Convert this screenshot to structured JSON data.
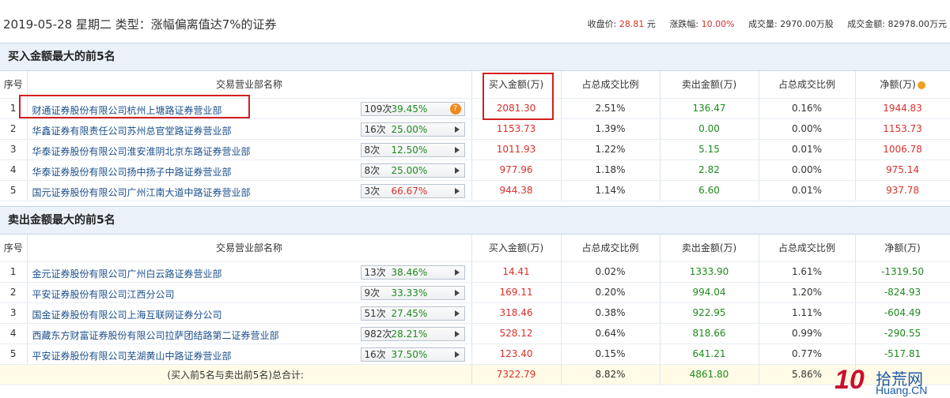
{
  "header": {
    "title": "2019-05-28 星期二  类型：涨幅偏离值达7%的证券",
    "stats": [
      {
        "label": "收盘价:",
        "value": "28.81",
        "unit": "元"
      },
      {
        "label": "涨跌幅:",
        "value": "10.00%",
        "unit": ""
      },
      {
        "label": "成交量:",
        "value": "2970.00万股",
        "unit": ""
      },
      {
        "label": "成交金额:",
        "value": "82978.00万元",
        "unit": ""
      }
    ]
  },
  "buy_section": {
    "title": "买入金额最大的前5名",
    "columns": [
      "序号",
      "交易营业部名称",
      "买入金额(万)",
      "占总成交比例",
      "卖出金额(万)",
      "占总成交比例",
      "净额(万)"
    ],
    "rows": [
      {
        "idx": "1",
        "name": "财通证券股份有限公司杭州上塘路证券营业部",
        "count": "109次",
        "pct": "39.45%",
        "buy": "2081.30",
        "buy_ratio": "2.51%",
        "sell": "136.47",
        "sell_ratio": "0.16%",
        "net": "1944.83"
      },
      {
        "idx": "2",
        "name": "华鑫证券有限责任公司苏州总官堂路证券营业部",
        "count": "16次",
        "pct": "25.00%",
        "buy": "1153.73",
        "buy_ratio": "1.39%",
        "sell": "0.00",
        "sell_ratio": "0.00%",
        "net": "1153.73"
      },
      {
        "idx": "3",
        "name": "华泰证券股份有限公司淮安淮阴北京东路证券营业部",
        "count": "8次",
        "pct": "12.50%",
        "buy": "1011.93",
        "buy_ratio": "1.22%",
        "sell": "5.15",
        "sell_ratio": "0.01%",
        "net": "1006.78"
      },
      {
        "idx": "4",
        "name": "华泰证券股份有限公司扬中扬子中路证券营业部",
        "count": "8次",
        "pct": "25.00%",
        "buy": "977.96",
        "buy_ratio": "1.18%",
        "sell": "2.82",
        "sell_ratio": "0.00%",
        "net": "975.14"
      },
      {
        "idx": "5",
        "name": "国元证券股份有限公司广州江南大道中路证券营业部",
        "count": "3次",
        "pct": "66.67%",
        "buy": "944.38",
        "buy_ratio": "1.14%",
        "sell": "6.60",
        "sell_ratio": "0.01%",
        "net": "937.78"
      }
    ]
  },
  "sell_section": {
    "title": "卖出金额最大的前5名",
    "columns": [
      "序号",
      "交易营业部名称",
      "买入金额(万)",
      "占总成交比例",
      "卖出金额(万)",
      "占总成交比例",
      "净额(万)"
    ],
    "rows": [
      {
        "idx": "1",
        "name": "金元证券股份有限公司广州白云路证券营业部",
        "count": "13次",
        "pct": "38.46%",
        "buy": "14.41",
        "buy_ratio": "0.02%",
        "sell": "1333.90",
        "sell_ratio": "1.61%",
        "net": "-1319.50"
      },
      {
        "idx": "2",
        "name": "平安证券股份有限公司江西分公司",
        "count": "9次",
        "pct": "33.33%",
        "buy": "169.11",
        "buy_ratio": "0.20%",
        "sell": "994.04",
        "sell_ratio": "1.20%",
        "net": "-824.93"
      },
      {
        "idx": "3",
        "name": "国金证券股份有限公司上海互联网证券分公司",
        "count": "51次",
        "pct": "27.45%",
        "buy": "318.46",
        "buy_ratio": "0.38%",
        "sell": "922.95",
        "sell_ratio": "1.11%",
        "net": "-604.49"
      },
      {
        "idx": "4",
        "name": "西藏东方财富证券股份有限公司拉萨团结路第二证券营业部",
        "count": "982次",
        "pct": "28.21%",
        "buy": "528.12",
        "buy_ratio": "0.64%",
        "sell": "818.66",
        "sell_ratio": "0.99%",
        "net": "-290.55"
      },
      {
        "idx": "5",
        "name": "平安证券股份有限公司芜湖黄山中路证券营业部",
        "count": "16次",
        "pct": "37.50%",
        "buy": "123.40",
        "buy_ratio": "0.15%",
        "sell": "641.21",
        "sell_ratio": "0.77%",
        "net": "-517.81"
      }
    ],
    "total": {
      "label": "(买入前5名与卖出前5名)总合计:",
      "buy": "7322.79",
      "buy_ratio": "8.82%",
      "sell": "4861.80",
      "sell_ratio": "5.86%",
      "net": ""
    }
  },
  "logo": {
    "num": "10",
    "cn": "拾荒网",
    "en": "Huang.CN"
  }
}
